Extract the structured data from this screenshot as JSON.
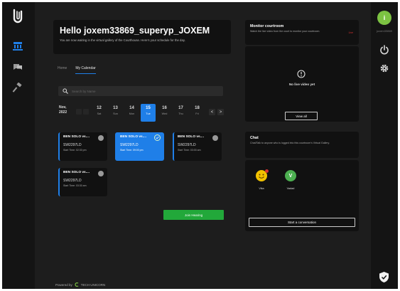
{
  "nav": {
    "items": [
      {
        "name": "courtroom",
        "active": true
      },
      {
        "name": "chat",
        "active": false
      },
      {
        "name": "gavel",
        "active": false
      }
    ]
  },
  "user": {
    "initial": "i",
    "name": "joxem33869"
  },
  "header": {
    "greeting": "Hello joxem33869_superyp_JOXEM",
    "subtitle": "You are now waiting in the virtual gallery of the Courthouse. Here's your schedule for the day."
  },
  "tabs": [
    {
      "label": "Home",
      "active": false
    },
    {
      "label": "My Calendar",
      "active": true
    }
  ],
  "search": {
    "placeholder": "Search by Name"
  },
  "calendar": {
    "month": "Nov,",
    "year": "2022",
    "days": [
      {
        "num": "12",
        "dow": "Sat",
        "active": false
      },
      {
        "num": "13",
        "dow": "Sun",
        "active": false
      },
      {
        "num": "14",
        "dow": "Mon",
        "active": false
      },
      {
        "num": "15",
        "dow": "Tue",
        "active": true
      },
      {
        "num": "16",
        "dow": "Wed",
        "active": false
      },
      {
        "num": "17",
        "dow": "Thu",
        "active": false
      },
      {
        "num": "18",
        "dow": "Fri",
        "active": false
      }
    ],
    "prev": "<",
    "next": ">"
  },
  "cases": [
    {
      "title": "BEN SOLO vs....",
      "code": "SW2297LD",
      "start": "Start Time: 02:30 pm",
      "active": false
    },
    {
      "title": "BEN SOLO vs....",
      "code": "SW2297LD",
      "start": "Start Time: 09:00 pm",
      "active": true
    },
    {
      "title": "BEN SOLO vs....",
      "code": "SW2297LD",
      "start": "Start Time: 03:00 am",
      "active": false
    },
    {
      "title": "BEN SOLO vs....",
      "code": "SW2297LD",
      "start": "Start Time: 03:30 am",
      "active": false
    }
  ],
  "join_label": "Join Hearing",
  "footer": {
    "powered": "Powered by",
    "brand": "TECH UNICORN"
  },
  "monitor": {
    "title": "Monitor courtroom",
    "subtitle": "Watch the live video from the court to monitor your courtroom.",
    "live": "Live",
    "no_video": "No live video yet",
    "view_all": "View all"
  },
  "chat": {
    "title": "Chat",
    "subtitle": "Chat/Talk to anyone who is logged into this courtroom's Virtual Gallery.",
    "members": [
      {
        "name": "Vika",
        "initial": "",
        "color": "#f2c200"
      },
      {
        "name": "Vadad",
        "initial": "V",
        "color": "#4caf50"
      }
    ],
    "start_label": "Start a conversation"
  },
  "colors": {
    "accent": "#1f7fe8",
    "join": "#22a83a",
    "avatar": "#7cc242",
    "live": "#d33333"
  }
}
